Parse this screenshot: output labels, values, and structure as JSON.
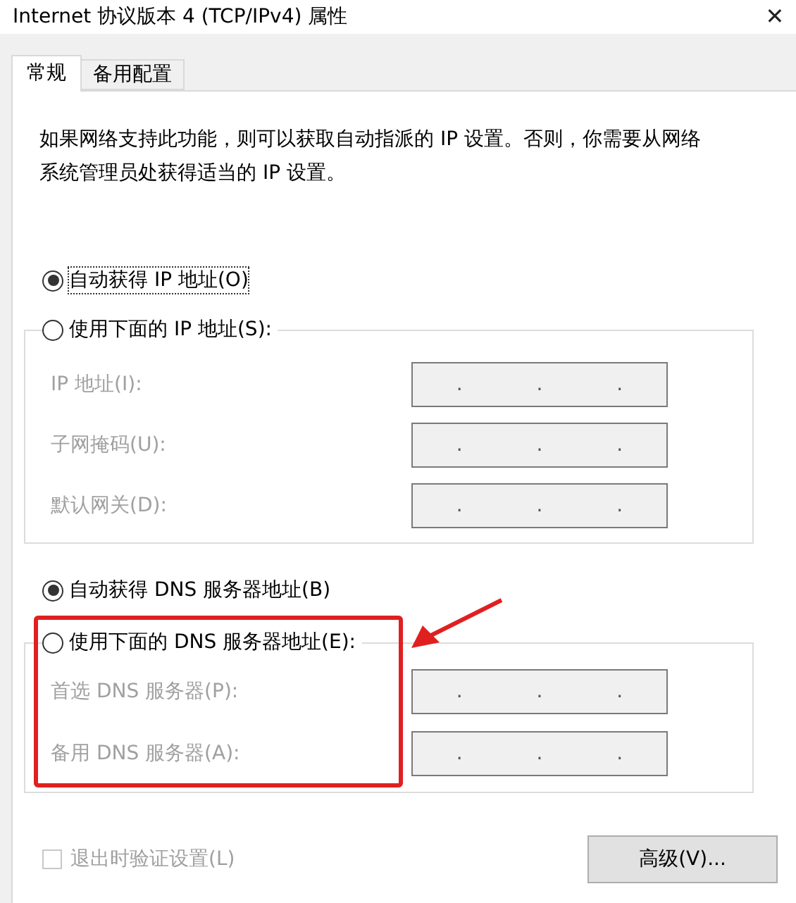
{
  "window": {
    "title": "Internet 协议版本 4 (TCP/IPv4) 属性",
    "close": "✕"
  },
  "tabs": [
    {
      "label": "常规",
      "selected": true
    },
    {
      "label": "备用配置",
      "selected": false
    }
  ],
  "description": "如果网络支持此功能，则可以获取自动指派的 IP 设置。否则，你需要从网络系统管理员处获得适当的 IP 设置。",
  "ip_group": {
    "options": [
      {
        "label": "自动获得 IP 地址(O)",
        "selected": true
      },
      {
        "label": "使用下面的 IP 地址(S):",
        "selected": false
      }
    ],
    "fields": [
      {
        "label": "IP 地址(I):",
        "value": ". . .",
        "disabled": true
      },
      {
        "label": "子网掩码(U):",
        "value": ". . .",
        "disabled": true
      },
      {
        "label": "默认网关(D):",
        "value": ". . .",
        "disabled": true
      }
    ]
  },
  "dns_group": {
    "options": [
      {
        "label": "自动获得 DNS 服务器地址(B)",
        "selected": true
      },
      {
        "label": "使用下面的 DNS 服务器地址(E):",
        "selected": false
      }
    ],
    "fields": [
      {
        "label": "首选 DNS 服务器(P):",
        "value": ". . .",
        "disabled": true
      },
      {
        "label": "备用 DNS 服务器(A):",
        "value": ". . .",
        "disabled": true
      }
    ]
  },
  "validate": {
    "label": "退出时验证设置(L)",
    "checked": false,
    "disabled": true
  },
  "advanced_button": {
    "label": "高级(V)..."
  }
}
